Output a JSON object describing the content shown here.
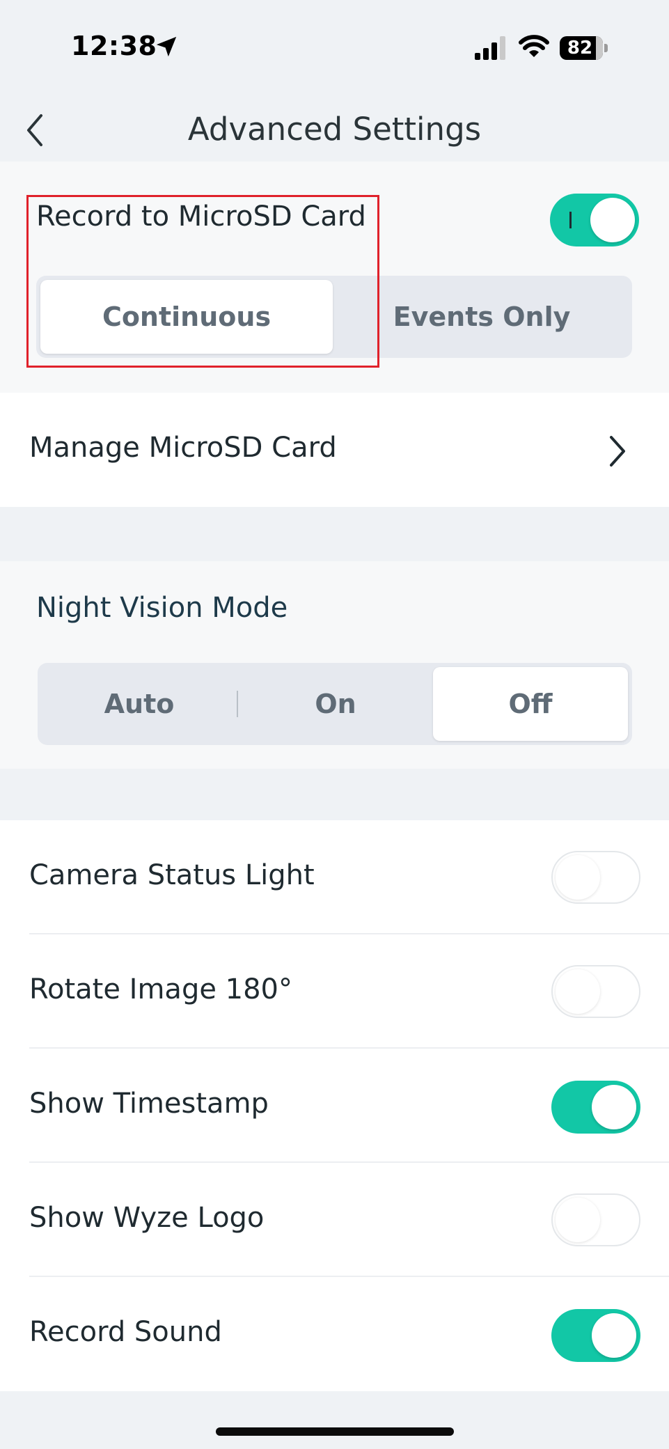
{
  "status_bar": {
    "time": "12:38",
    "battery": "82",
    "icons": [
      "location-arrow-icon",
      "cellular-signal-icon",
      "wifi-icon",
      "battery-icon"
    ]
  },
  "nav": {
    "title": "Advanced Settings",
    "back_icon": "chevron-left-icon"
  },
  "record_sd": {
    "label": "Record to MicroSD Card",
    "enabled": true,
    "modes": [
      "Continuous",
      "Events Only"
    ],
    "selected_mode": "Continuous"
  },
  "manage_sd": {
    "label": "Manage MicroSD Card",
    "icon": "chevron-right-icon"
  },
  "night_vision": {
    "label": "Night Vision Mode",
    "options": [
      "Auto",
      "On",
      "Off"
    ],
    "selected": "Off"
  },
  "toggles": [
    {
      "label": "Camera Status Light",
      "on": false
    },
    {
      "label": "Rotate Image 180°",
      "on": false
    },
    {
      "label": "Show Timestamp",
      "on": true
    },
    {
      "label": "Show Wyze Logo",
      "on": false
    },
    {
      "label": "Record Sound",
      "on": true
    }
  ],
  "colors": {
    "accent": "#12c7a6",
    "highlight_box": "#e0212b",
    "background": "#eff2f5"
  }
}
